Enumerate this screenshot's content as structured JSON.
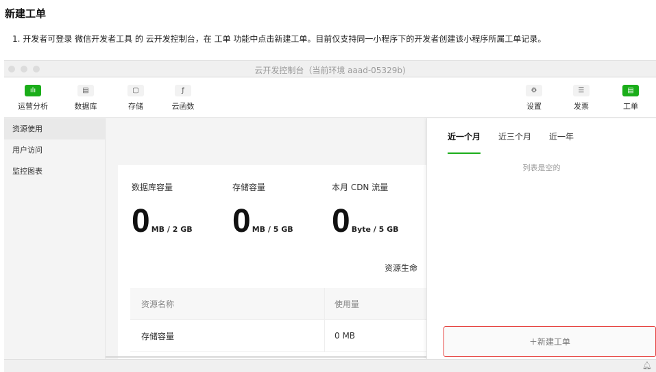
{
  "doc": {
    "title": "新建工单",
    "step": "1. 开发者可登录 微信开发者工具 的 云开发控制台，在 工单 功能中点击新建工单。目前仅支持同一小程序下的开发者创建该小程序所属工单记录。"
  },
  "window": {
    "title": "云开发控制台（当前环境 aaad-05329b)"
  },
  "toolbar": {
    "left": [
      {
        "label": "运营分析",
        "icon": "chart-icon",
        "glyph": "ılı",
        "active": true
      },
      {
        "label": "数据库",
        "icon": "database-icon",
        "glyph": "▤",
        "active": false
      },
      {
        "label": "存储",
        "icon": "storage-icon",
        "glyph": "▢",
        "active": false
      },
      {
        "label": "云函数",
        "icon": "cloud-function-icon",
        "glyph": "ƒ",
        "active": false
      }
    ],
    "right": [
      {
        "label": "设置",
        "icon": "gear-icon",
        "glyph": "⚙",
        "active": false
      },
      {
        "label": "发票",
        "icon": "invoice-icon",
        "glyph": "☰",
        "active": false
      },
      {
        "label": "工单",
        "icon": "ticket-icon",
        "glyph": "▤",
        "active": true
      }
    ]
  },
  "sidebar": {
    "items": [
      {
        "label": "资源使用",
        "active": true
      },
      {
        "label": "用户访问",
        "active": false
      },
      {
        "label": "监控图表",
        "active": false
      }
    ]
  },
  "main": {
    "metrics": [
      {
        "title": "数据库容量",
        "value": "0",
        "unit": "MB / 2 GB"
      },
      {
        "title": "存储容量",
        "value": "0",
        "unit": "MB / 5 GB"
      },
      {
        "title": "本月 CDN 流量",
        "value": "0",
        "unit": "Byte / 5 GB"
      }
    ],
    "section_title": "资源生命",
    "table": {
      "headers": [
        "资源名称",
        "使用量"
      ],
      "rows": [
        [
          "存储容量",
          "0 MB"
        ]
      ]
    }
  },
  "panel": {
    "tabs": [
      {
        "label": "近一个月",
        "active": true
      },
      {
        "label": "近三个月",
        "active": false
      },
      {
        "label": "近一年",
        "active": false
      }
    ],
    "empty_text": "列表是空的",
    "new_button": "＋新建工单"
  },
  "statusbar": {
    "icon": "bell-icon"
  },
  "colors": {
    "accent": "#1aad19",
    "highlight": "#e64340"
  }
}
